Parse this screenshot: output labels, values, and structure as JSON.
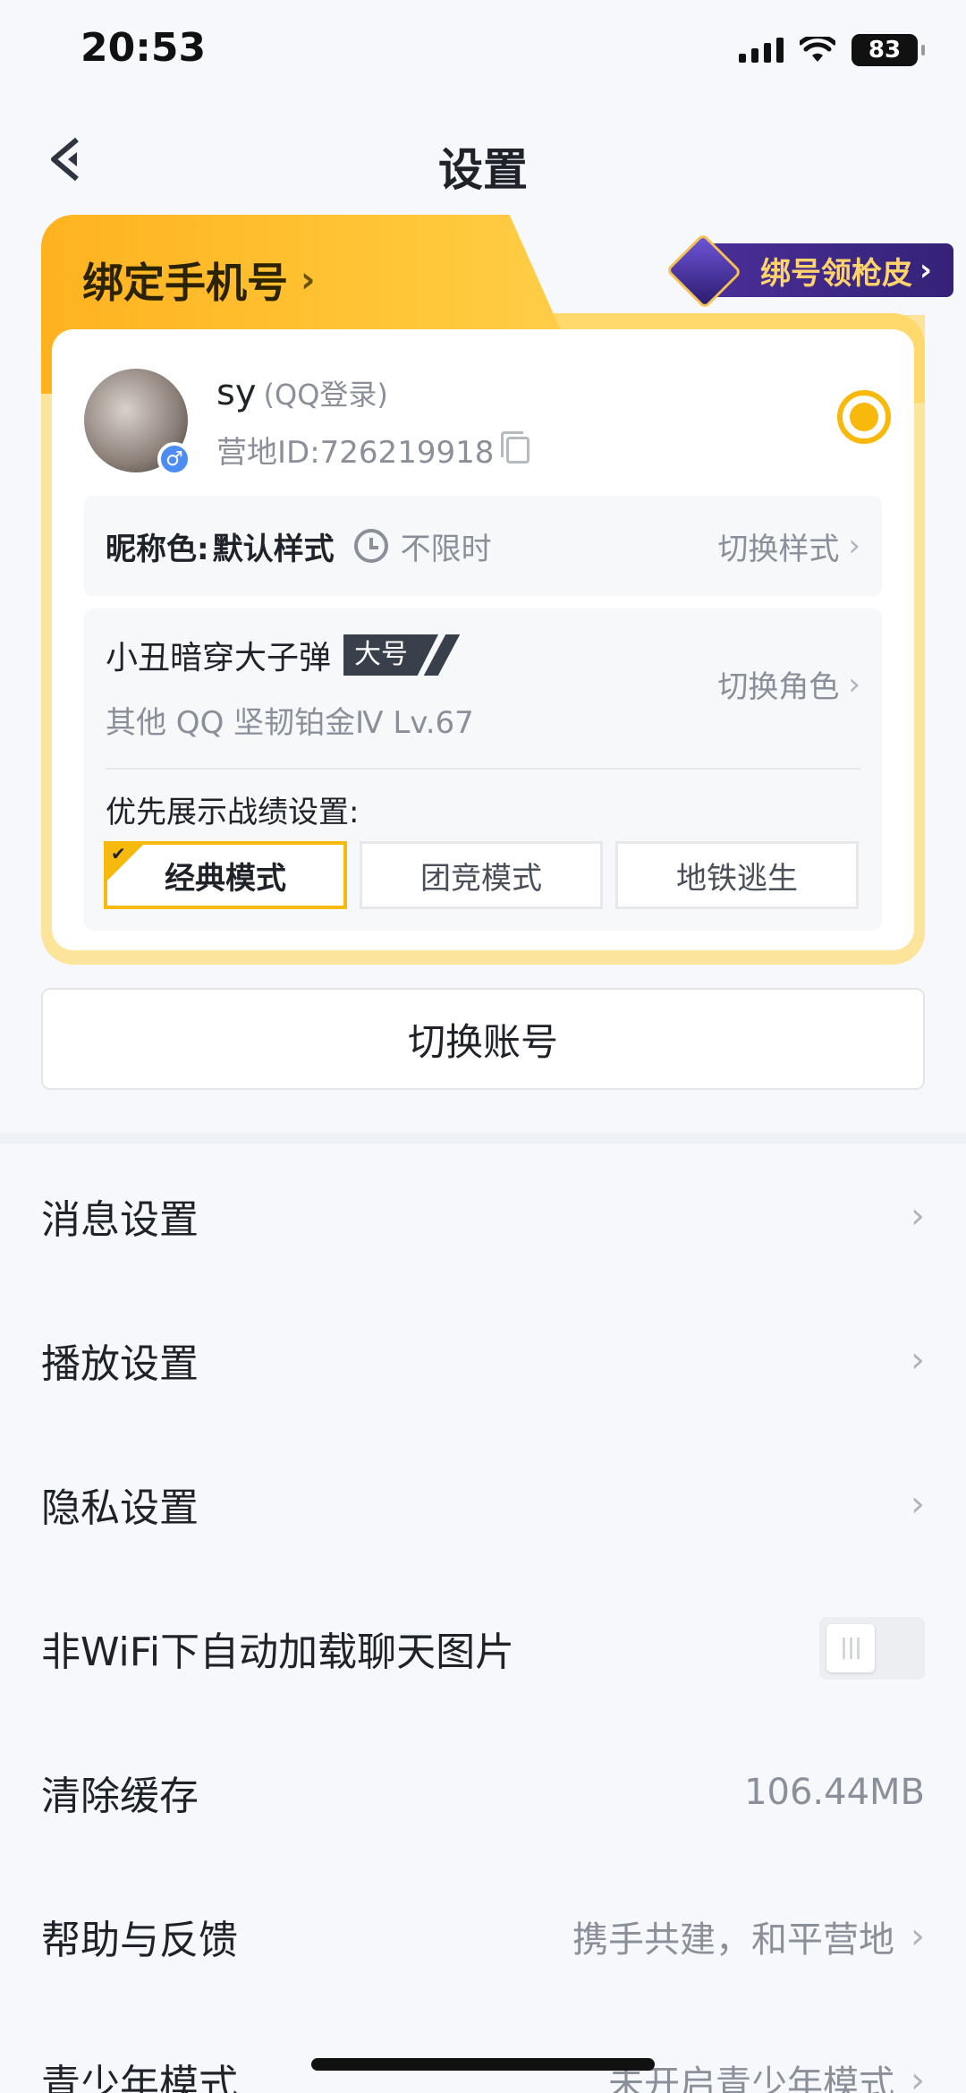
{
  "status_bar": {
    "time": "20:53",
    "battery": "83"
  },
  "nav": {
    "title": "设置"
  },
  "bind_card": {
    "bind_phone_label": "绑定手机号",
    "promo_label": "绑号领枪皮",
    "user": {
      "name": "sy",
      "login_type": "(QQ登录)",
      "camp_id": "营地ID:726219918"
    },
    "nickname": {
      "label": "昵称色:",
      "value": "默认样式",
      "duration": "不限时",
      "switch_label": "切换样式"
    },
    "role": {
      "name": "小丑暗穿大子弹",
      "tag": "大号",
      "info": "其他 QQ  坚韧铂金Ⅳ  Lv.67",
      "switch_label": "切换角色"
    },
    "priority": {
      "label": "优先展示战绩设置:",
      "modes": [
        "经典模式",
        "团竞模式",
        "地铁逃生"
      ],
      "selected": "经典模式"
    }
  },
  "switch_account_label": "切换账号",
  "menu": [
    {
      "label": "消息设置"
    },
    {
      "label": "播放设置"
    },
    {
      "label": "隐私设置"
    },
    {
      "label": "非WiFi下自动加载聊天图片"
    },
    {
      "label": "清除缓存",
      "value": "106.44MB"
    },
    {
      "label": "帮助与反馈",
      "value": "携手共建，和平营地"
    },
    {
      "label": "青少年模式",
      "value": "未开启青少年模式"
    }
  ]
}
